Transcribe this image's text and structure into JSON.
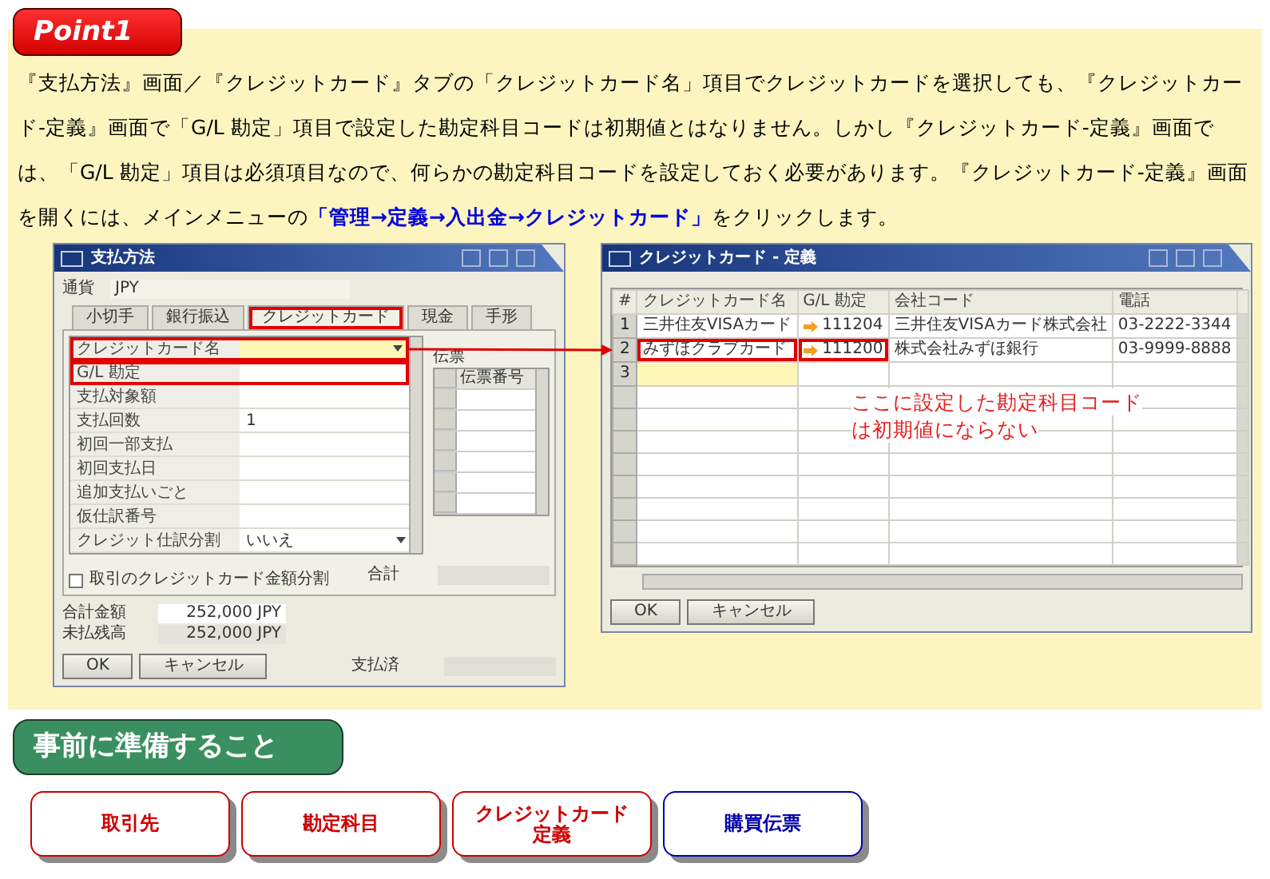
{
  "point_badge": "Point1",
  "paragraph": {
    "text": "『支払方法』画面／『クレジットカード』タブの「クレジットカード名」項目でクレジットカードを選択しても、『クレジットカード‐定義』画面で「G/L 勘定」項目で設定した勘定科目コードは初期値とはなりません。しかし『クレジットカード‐定義』画面では、「G/L 勘定」項目は必須項目なので、何らかの勘定科目コードを設定しておく必要があります。『クレジットカード‐定義』画面を開くには、メインメニューの",
    "link": "「管理→定義→入出金→クレジットカード」",
    "suffix": "をクリックします。"
  },
  "payment_window": {
    "title": "支払方法",
    "currency_label": "通貨",
    "currency_value": "JPY",
    "tabs": [
      {
        "label": "小切手",
        "selected": false,
        "highlighted": false
      },
      {
        "label": "銀行振込",
        "selected": false,
        "highlighted": false
      },
      {
        "label": "クレジットカード",
        "selected": true,
        "highlighted": true
      },
      {
        "label": "現金",
        "selected": false,
        "highlighted": false
      },
      {
        "label": "手形",
        "selected": false,
        "highlighted": false
      }
    ],
    "fields": [
      {
        "label": "クレジットカード名",
        "kind": "dropdown",
        "highlighted": true,
        "focused": true
      },
      {
        "label": "G/L 勘定",
        "kind": "text",
        "highlighted": true,
        "focused": false
      },
      {
        "label": "支払対象額",
        "kind": "text",
        "highlighted": false,
        "focused": false
      },
      {
        "label": "支払回数",
        "kind": "text",
        "value": "1",
        "highlighted": false,
        "focused": false
      },
      {
        "label": "初回一部支払",
        "kind": "text",
        "highlighted": false,
        "focused": false
      },
      {
        "label": "初回支払日",
        "kind": "text",
        "highlighted": false,
        "focused": false
      },
      {
        "label": "追加支払いごと",
        "kind": "text",
        "highlighted": false,
        "focused": false
      },
      {
        "label": "仮仕訳番号",
        "kind": "text",
        "highlighted": false,
        "focused": false
      },
      {
        "label": "クレジット仕訳分割",
        "kind": "dropdown",
        "value": "いいえ",
        "highlighted": false,
        "focused": false
      }
    ],
    "detail_label": "伝票",
    "detail_column": "伝票番号",
    "checkbox": {
      "label": "取引のクレジットカード金額分割",
      "checked": false
    },
    "total_label": "合計",
    "summary": [
      {
        "label": "合計金額",
        "value": "252,000 JPY",
        "editable": true
      },
      {
        "label": "未払残高",
        "value": "252,000 JPY",
        "editable": false
      }
    ],
    "buttons": [
      "OK",
      "キャンセル"
    ],
    "paid_label": "支払済"
  },
  "card_window": {
    "title": "クレジットカード - 定義",
    "columns": [
      "#",
      "クレジットカード名",
      "G/L 勘定",
      "会社コード",
      "電話"
    ],
    "rows": [
      {
        "num": "1",
        "name": "三井住友VISAカード",
        "gl": "111204",
        "company": "三井住友VISAカード株式会社",
        "phone": "03-2222-3344",
        "highlighted": false,
        "focused": false
      },
      {
        "num": "2",
        "name": "みずほクラブカード",
        "gl": "111200",
        "company": "株式会社みずほ銀行",
        "phone": "03-9999-8888",
        "highlighted": true,
        "focused": false
      },
      {
        "num": "3",
        "highlighted": false,
        "focused": true
      }
    ],
    "note": [
      "ここに設定した勘定科目コード",
      "は初期値にならない"
    ],
    "buttons": [
      "OK",
      "キャンセル"
    ]
  },
  "prep_heading": "事前に準備すること",
  "prep_buttons": [
    {
      "label_lines": [
        "取引先"
      ],
      "color": "#cc0000"
    },
    {
      "label_lines": [
        "勘定科目"
      ],
      "color": "#cc0000"
    },
    {
      "label_lines": [
        "クレジットカード",
        "定義"
      ],
      "color": "#cc0000"
    },
    {
      "label_lines": [
        "購買伝票"
      ],
      "color": "#0000aa"
    }
  ]
}
